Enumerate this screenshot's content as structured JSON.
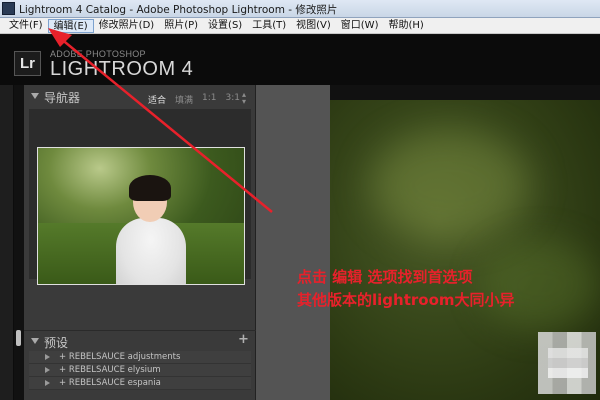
{
  "window": {
    "title": "Lightroom 4 Catalog - Adobe Photoshop Lightroom - 修改照片"
  },
  "menu": [
    {
      "label": "文件(F)"
    },
    {
      "label": "编辑(E)"
    },
    {
      "label": "修改照片(D)"
    },
    {
      "label": "照片(P)"
    },
    {
      "label": "设置(S)"
    },
    {
      "label": "工具(T)"
    },
    {
      "label": "视图(V)"
    },
    {
      "label": "窗口(W)"
    },
    {
      "label": "帮助(H)"
    }
  ],
  "identity": {
    "badge": "Lr",
    "adobe": "ADOBE PHOTOSHOP",
    "product": "LIGHTROOM 4"
  },
  "navigator": {
    "label": "导航器",
    "zoom_options": [
      "适合",
      "填满",
      "1:1",
      "3:1"
    ],
    "selected_zoom": "适合"
  },
  "presets": {
    "label": "预设",
    "add": "+",
    "items": [
      "+ REBELSAUCE adjustments",
      "+ REBELSAUCE elysium",
      "+ REBELSAUCE espania"
    ]
  },
  "annotation": {
    "line1": "点击 编辑 选项找到首选项",
    "line2": "其他版本的lightroom大同小异",
    "color": "#e8212b"
  }
}
